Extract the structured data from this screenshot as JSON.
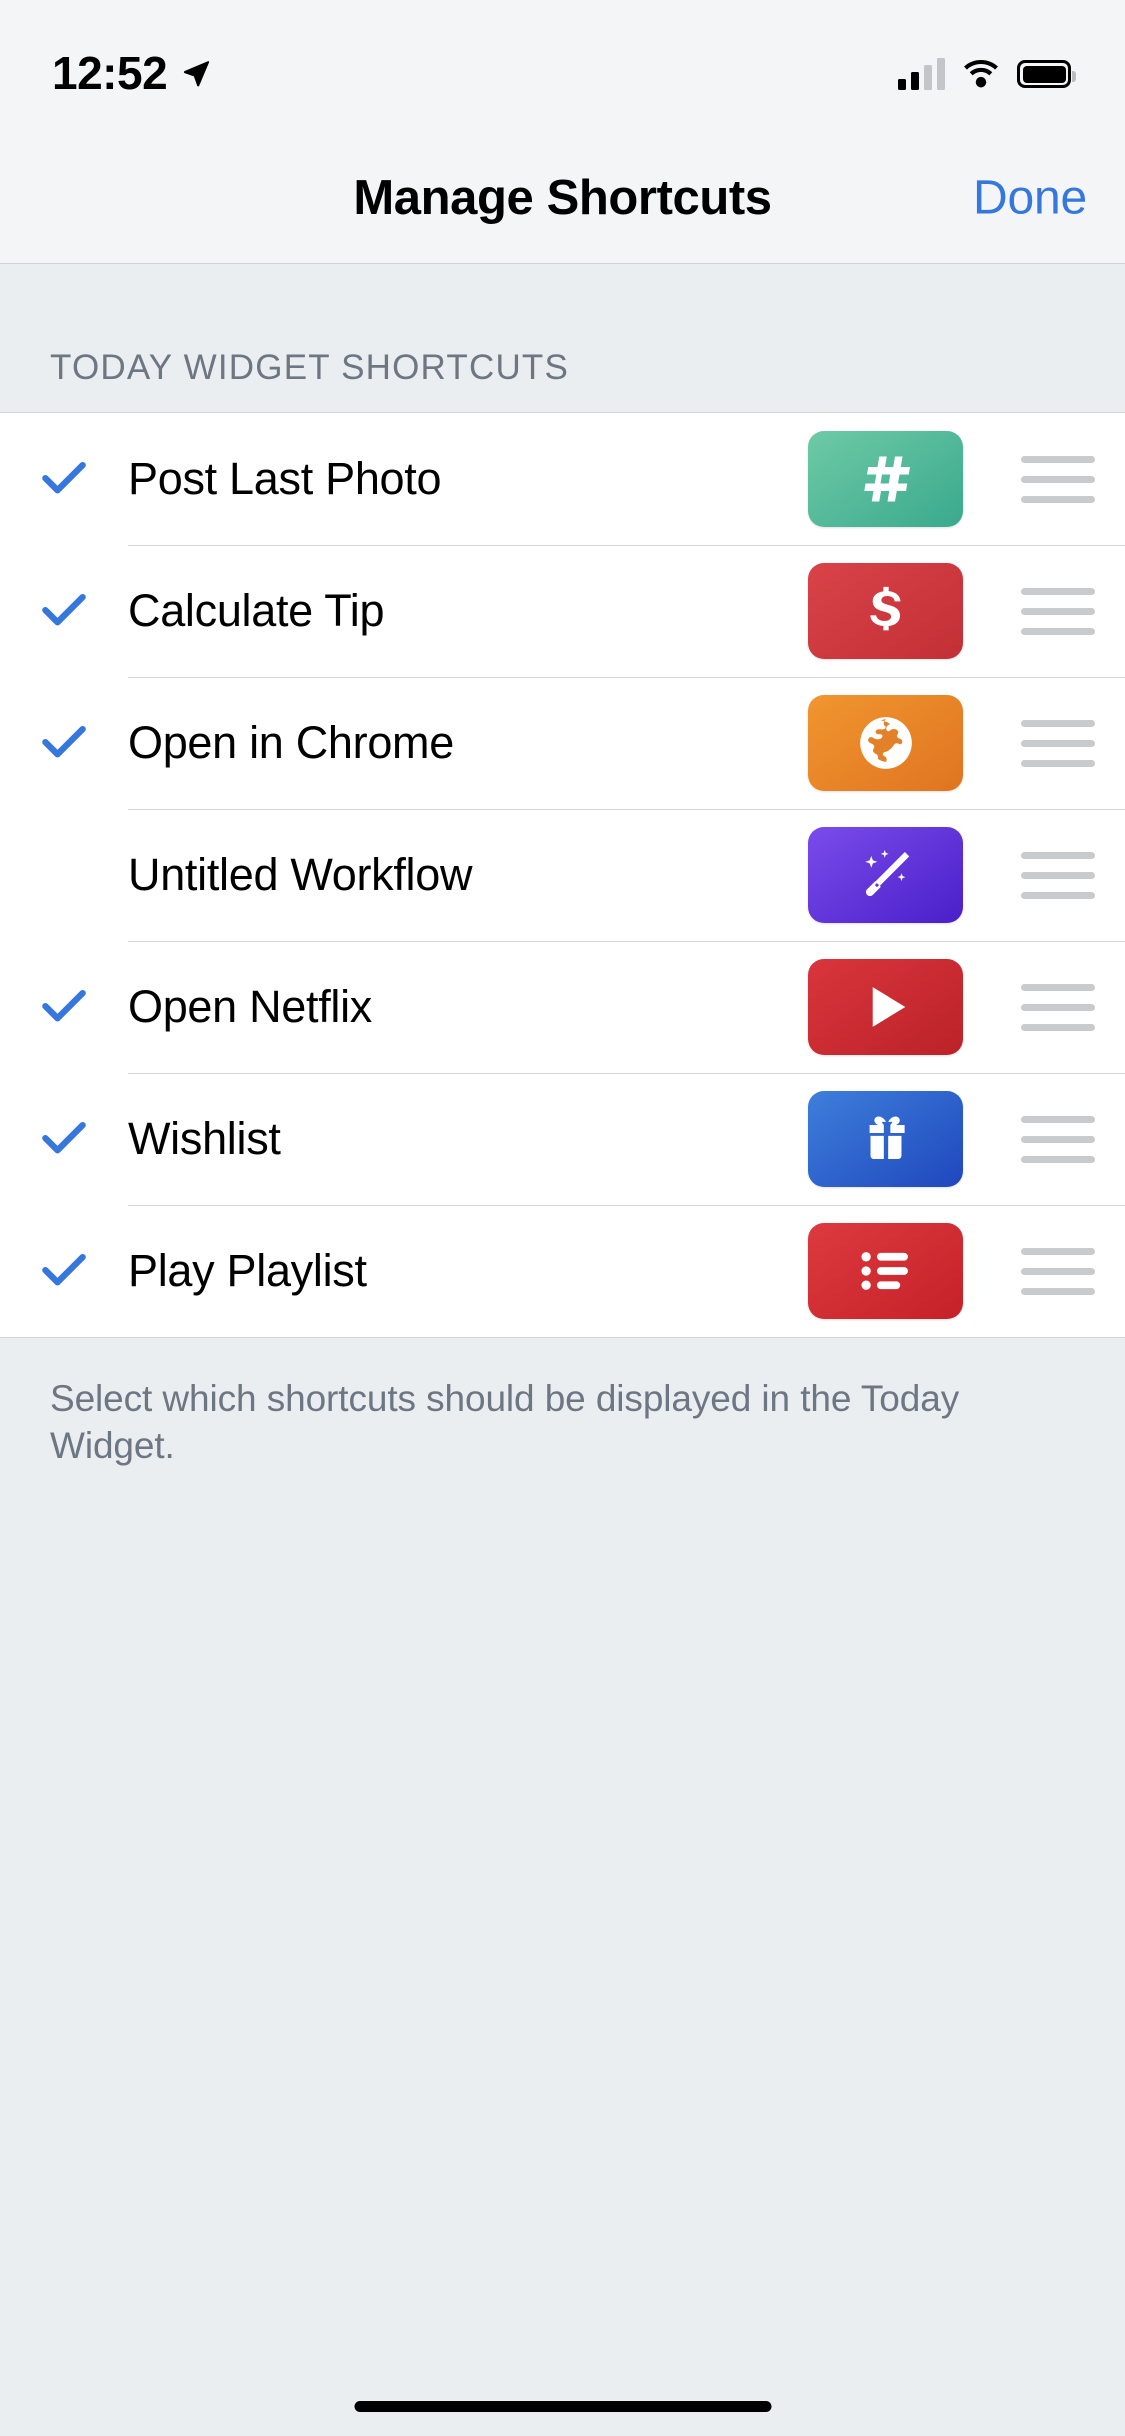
{
  "status_bar": {
    "time": "12:52",
    "location_icon": "location-arrow-icon",
    "cellular_icon": "cellular-signal-icon",
    "cellular_bars_filled": 2,
    "cellular_bars_total": 4,
    "wifi_icon": "wifi-icon",
    "battery_icon": "battery-full-icon"
  },
  "nav": {
    "title": "Manage Shortcuts",
    "done_label": "Done",
    "done_color": "#3577dd"
  },
  "section": {
    "header": "TODAY WIDGET SHORTCUTS",
    "footer": "Select which shortcuts should be displayed in the Today Widget."
  },
  "rows": [
    {
      "label": "Post Last Photo",
      "checked": true,
      "icon_name": "hashtag-icon",
      "tile_color_start": "#6ecaa6",
      "tile_color_end": "#3aa98d"
    },
    {
      "label": "Calculate Tip",
      "checked": true,
      "icon_name": "dollar-sign-icon",
      "tile_color_start": "#d94348",
      "tile_color_end": "#c22f36"
    },
    {
      "label": "Open in Chrome",
      "checked": true,
      "icon_name": "globe-icon",
      "tile_color_start": "#f0962f",
      "tile_color_end": "#e07421"
    },
    {
      "label": "Untitled Workflow",
      "checked": false,
      "icon_name": "magic-wand-icon",
      "tile_color_start": "#7a4ceb",
      "tile_color_end": "#4a1fc9"
    },
    {
      "label": "Open Netflix",
      "checked": true,
      "icon_name": "play-triangle-icon",
      "tile_color_start": "#d9353c",
      "tile_color_end": "#bb2228"
    },
    {
      "label": "Wishlist",
      "checked": true,
      "icon_name": "gift-icon",
      "tile_color_start": "#3e7fdb",
      "tile_color_end": "#1f47bd"
    },
    {
      "label": "Play Playlist",
      "checked": true,
      "icon_name": "bulleted-list-icon",
      "tile_color_start": "#dd3a40",
      "tile_color_end": "#c42228"
    }
  ],
  "reorder_handle_icon": "reorder-handle-icon",
  "checkmark_color": "#3577dd",
  "home_indicator": "home-indicator"
}
